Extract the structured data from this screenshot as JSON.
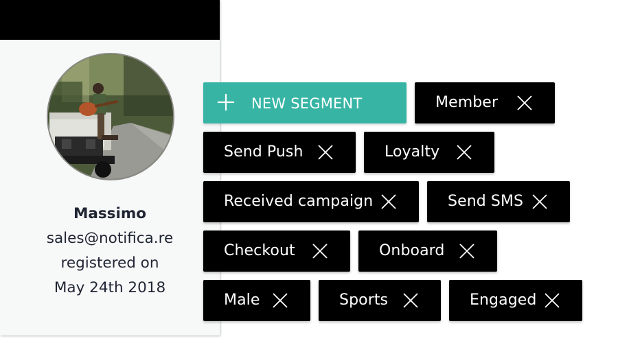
{
  "profile": {
    "name": "Massimo",
    "email": "sales@notifica.re",
    "registered_label": "registered on",
    "registered_date": "May 24th 2018",
    "avatar_icon": "user-photo"
  },
  "new_segment": {
    "label": "NEW SEGMENT",
    "icon": "plus-icon"
  },
  "tags": [
    {
      "label": "Member"
    },
    {
      "label": "Send Push"
    },
    {
      "label": "Loyalty"
    },
    {
      "label": "Received campaign"
    },
    {
      "label": "Send SMS"
    },
    {
      "label": "Checkout"
    },
    {
      "label": "Onboard"
    },
    {
      "label": "Male"
    },
    {
      "label": "Sports"
    },
    {
      "label": "Engaged"
    }
  ],
  "colors": {
    "accent": "#37b4a4",
    "tag_bg": "#000000",
    "tag_text": "#ffffff",
    "card_bg": "#f7f8f8",
    "text_dark": "#1f2533"
  }
}
